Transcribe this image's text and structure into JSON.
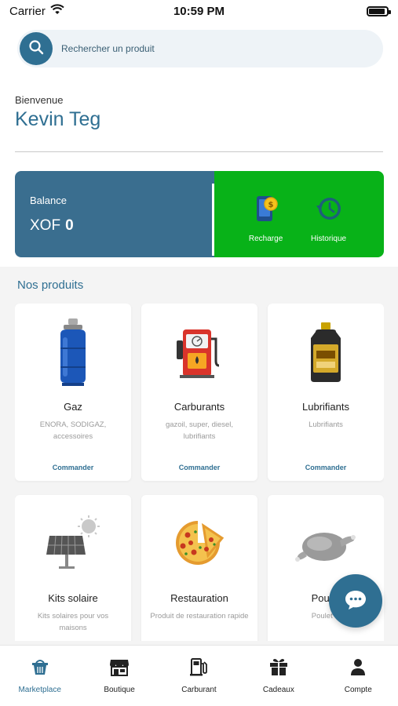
{
  "status_bar": {
    "carrier": "Carrier",
    "time": "10:59 PM",
    "battery_level": 0.92
  },
  "search": {
    "placeholder": "Rechercher un produit"
  },
  "welcome": {
    "label": "Bienvenue",
    "user_name": "Kevin Teg"
  },
  "balance": {
    "label": "Balance",
    "currency": "XOF",
    "amount": "0",
    "actions": [
      {
        "label": "Recharge",
        "icon": "wallet-coin-icon"
      },
      {
        "label": "Historique",
        "icon": "history-clock-icon"
      }
    ]
  },
  "products": {
    "title": "Nos produits",
    "cta_label": "Commander",
    "items": [
      {
        "name": "Gaz",
        "desc": "ENORA, SODIGAZ, accessoires",
        "icon": "gas-cylinder-icon"
      },
      {
        "name": "Carburants",
        "desc": "gazoil, super, diesel, lubrifiants",
        "icon": "fuel-pump-icon"
      },
      {
        "name": "Lubrifiants",
        "desc": "Lubrifiants",
        "icon": "oil-bottle-icon"
      },
      {
        "name": "Kits solaire",
        "desc": "Kits solaires pour vos maisons",
        "icon": "solar-panel-icon"
      },
      {
        "name": "Restauration",
        "desc": "Produit de restauration rapide",
        "icon": "pizza-icon"
      },
      {
        "name": "Poulet",
        "desc": "Poulet D",
        "icon": "chicken-icon"
      }
    ]
  },
  "fab": {
    "icon": "chat-bubble-icon"
  },
  "bottom_nav": {
    "active": "Marketplace",
    "items": [
      {
        "label": "Marketplace",
        "icon": "basket-icon"
      },
      {
        "label": "Boutique",
        "icon": "store-icon"
      },
      {
        "label": "Carburant",
        "icon": "fuel-station-icon"
      },
      {
        "label": "Cadeaux",
        "icon": "gift-icon"
      },
      {
        "label": "Compte",
        "icon": "user-icon"
      }
    ]
  },
  "colors": {
    "primary": "#2f6f92",
    "balance_bg": "#3a6e8f",
    "actions_bg": "#08b218",
    "section_bg": "#f4f4f4"
  }
}
